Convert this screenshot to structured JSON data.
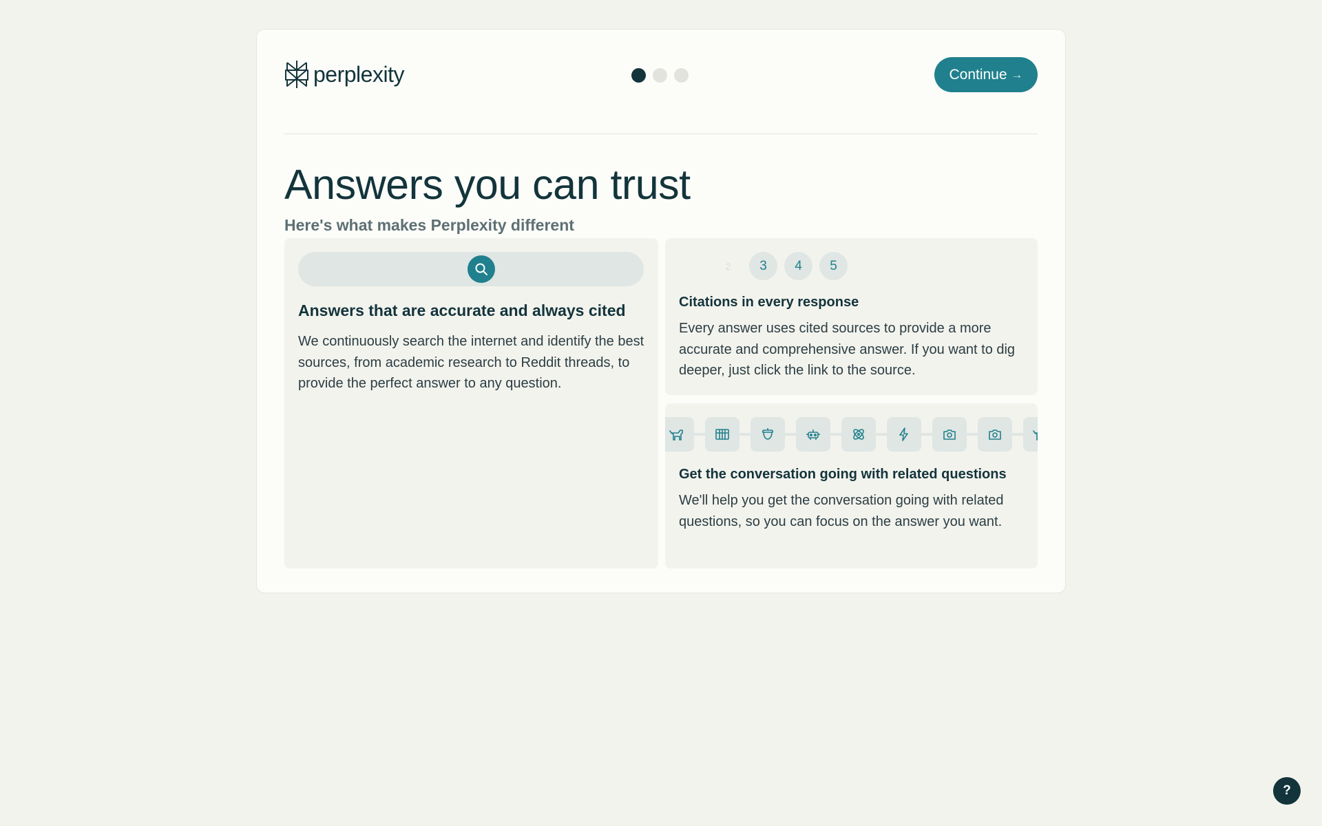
{
  "brand": {
    "name": "perplexity",
    "accent": "#20808d",
    "dark": "#13343b"
  },
  "header": {
    "steps_total": 3,
    "step_current": 1,
    "continue_label": "Continue",
    "continue_icon": "arrow-right-icon"
  },
  "hero": {
    "title": "Answers you can trust",
    "subtitle": "Here's what makes Perplexity different"
  },
  "features": {
    "accurate": {
      "icon": "search-icon",
      "title": "Answers that are accurate and always cited",
      "body": "We continuously search the internet and identify the best sources, from academic research to Reddit threads, to provide the perfect answer to any question."
    },
    "citations": {
      "numbers": [
        "2",
        "3",
        "4",
        "5"
      ],
      "title": "Citations in every response",
      "body": "Every answer uses cited sources to provide a more accurate and comprehensive answer. If you want to dig deeper, just click the link to the source."
    },
    "related": {
      "icons": [
        "dog-icon",
        "grid-table-icon",
        "acorn-icon",
        "robot-icon",
        "atom-icon",
        "lightning-icon",
        "camera-icon",
        "camera-icon",
        "dog-icon"
      ],
      "title": "Get the conversation going with related questions",
      "body": "We'll help you get the conversation going with related questions, so you can focus on the answer you want."
    }
  },
  "help": {
    "label": "?"
  }
}
